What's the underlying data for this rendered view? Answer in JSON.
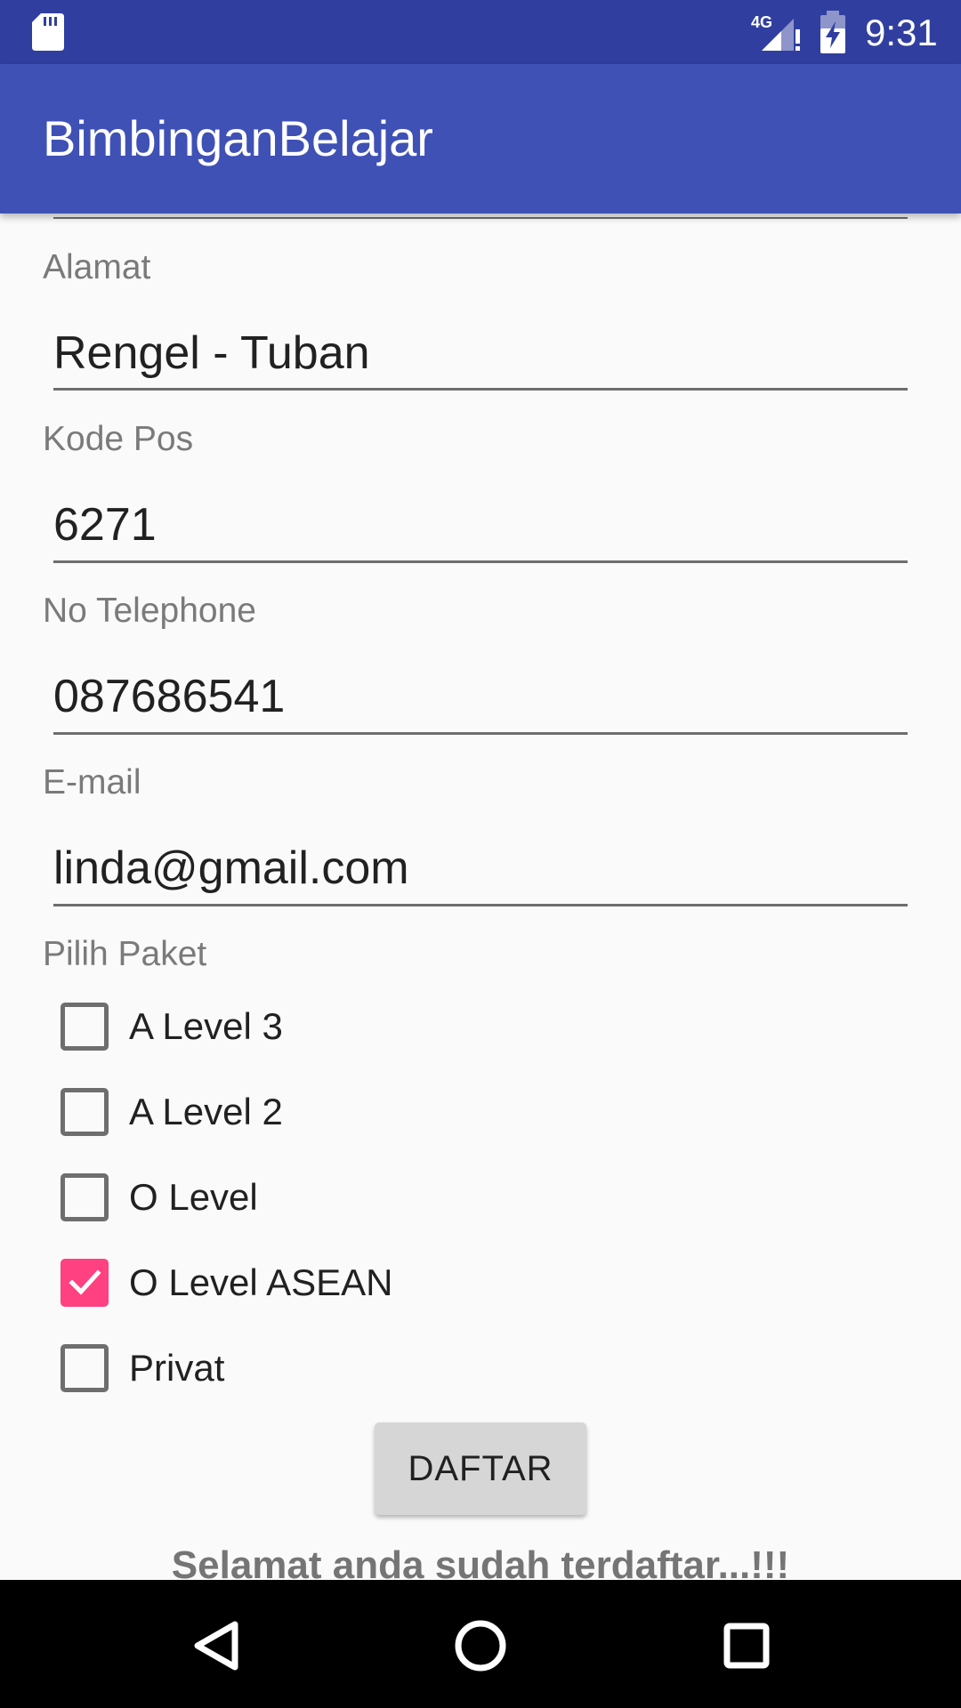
{
  "status_bar": {
    "time": "9:31",
    "network_badge": "4G",
    "icons": [
      "sd-card-icon",
      "signal-4g-icon",
      "battery-charging-icon"
    ]
  },
  "app_bar": {
    "title": "BimbinganBelajar"
  },
  "form": {
    "fields": [
      {
        "label": "Alamat",
        "value": "Rengel - Tuban"
      },
      {
        "label": "Kode Pos",
        "value": "6271"
      },
      {
        "label": "No Telephone",
        "value": "087686541"
      },
      {
        "label": "E-mail",
        "value": "linda@gmail.com"
      }
    ],
    "package_label": "Pilih Paket",
    "packages": [
      {
        "label": "A Level 3",
        "checked": false
      },
      {
        "label": "A Level 2",
        "checked": false
      },
      {
        "label": "O Level",
        "checked": false
      },
      {
        "label": "O Level ASEAN",
        "checked": true
      },
      {
        "label": "Privat",
        "checked": false
      }
    ],
    "submit_label": "DAFTAR",
    "success_message": "Selamat anda sudah terdaftar...!!!"
  },
  "navigation": {
    "icons": [
      "back-icon",
      "home-icon",
      "recents-icon"
    ]
  },
  "colors": {
    "status_bar": "#303F9F",
    "app_bar": "#3F51B5",
    "accent": "#FF4081",
    "background": "#FAFAFA"
  }
}
